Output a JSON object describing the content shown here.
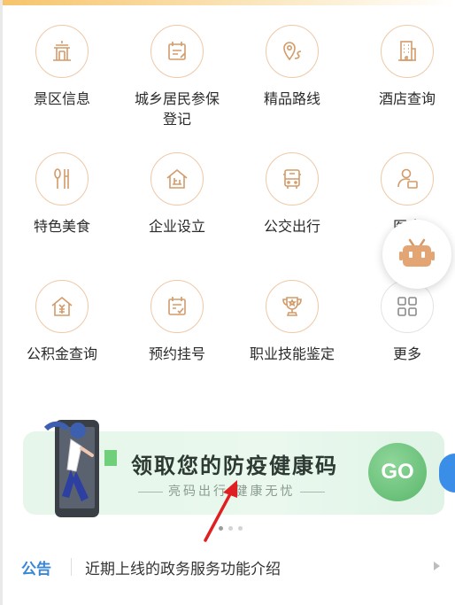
{
  "grid": {
    "row1": [
      {
        "label": "景区信息",
        "icon": "scenic-building-icon"
      },
      {
        "label": "城乡居民参保登记",
        "icon": "registration-form-icon"
      },
      {
        "label": "精品路线",
        "icon": "route-pin-icon"
      },
      {
        "label": "酒店查询",
        "icon": "hotel-building-icon"
      }
    ],
    "row2": [
      {
        "label": "特色美食",
        "icon": "fork-spoon-icon"
      },
      {
        "label": "企业设立",
        "icon": "enterprise-house-icon"
      },
      {
        "label": "公交出行",
        "icon": "bus-icon"
      },
      {
        "label": "医疗",
        "icon": "medical-person-icon"
      }
    ],
    "row3": [
      {
        "label": "公积金查询",
        "icon": "housing-fund-icon"
      },
      {
        "label": "预约挂号",
        "icon": "appointment-calendar-icon"
      },
      {
        "label": "职业技能鉴定",
        "icon": "trophy-icon"
      },
      {
        "label": "更多",
        "icon": "more-grid-icon"
      }
    ]
  },
  "banner": {
    "title": "领取您的防疫健康码",
    "subtitle": "亮码出行 健康无忧",
    "button_label": "GO"
  },
  "carousel": {
    "count": 3,
    "active": 0
  },
  "notice": {
    "tag": "公告",
    "text": "近期上线的政务服务功能介绍"
  },
  "colors": {
    "icon_stroke": "#d39b6a",
    "circle_border": "#edc9a8",
    "notice_tag": "#3a86d6",
    "go_button": "#5ab76b",
    "banner_bg": "#e6f6ea",
    "arrow_annotation": "#e02020"
  }
}
